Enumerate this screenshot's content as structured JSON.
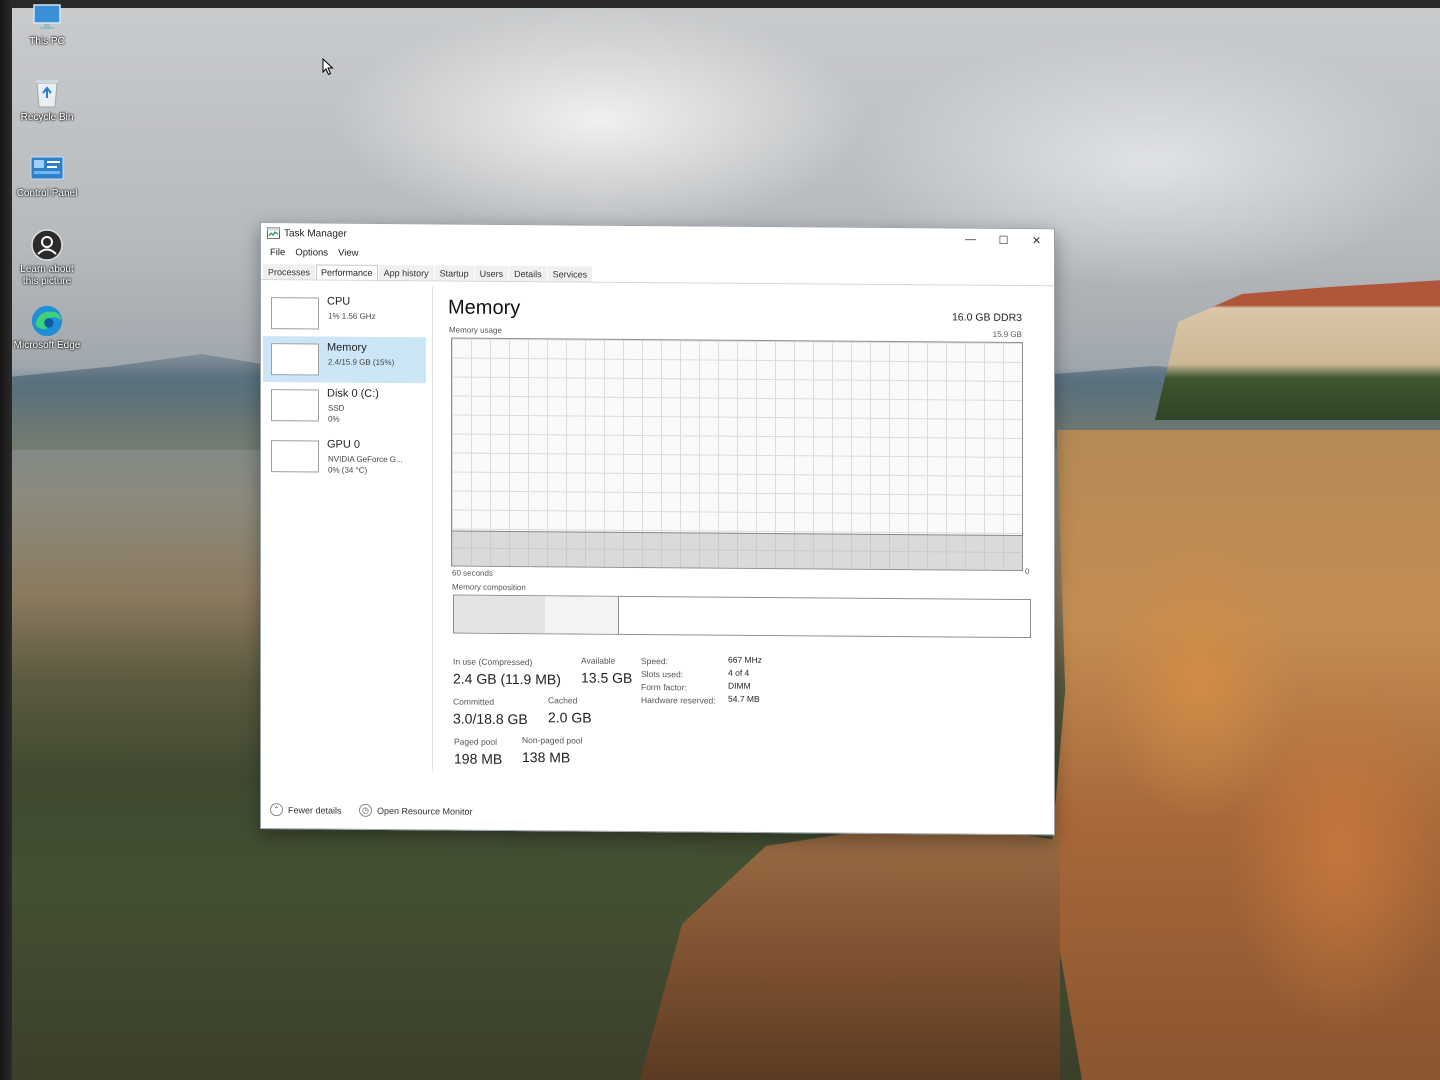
{
  "desktop": {
    "icons": [
      {
        "label": "This PC",
        "icon": "monitor-icon"
      },
      {
        "label": "Recycle Bin",
        "icon": "recycle-bin-icon"
      },
      {
        "label": "Control Panel",
        "icon": "control-panel-icon"
      },
      {
        "label": "Learn about this picture",
        "icon": "camera-icon"
      },
      {
        "label": "Microsoft Edge",
        "icon": "edge-icon"
      }
    ]
  },
  "window": {
    "title": "Task Manager",
    "controls": {
      "minimize": "—",
      "maximize": "☐",
      "close": "✕"
    },
    "menu": [
      "File",
      "Options",
      "View"
    ],
    "tabs": [
      "Processes",
      "Performance",
      "App history",
      "Startup",
      "Users",
      "Details",
      "Services"
    ],
    "active_tab": "Performance"
  },
  "sidebar": {
    "items": [
      {
        "name": "CPU",
        "line1": "1%  1.56 GHz",
        "line2": ""
      },
      {
        "name": "Memory",
        "line1": "2.4/15.9 GB (15%)",
        "line2": ""
      },
      {
        "name": "Disk 0 (C:)",
        "line1": "SSD",
        "line2": "0%"
      },
      {
        "name": "GPU 0",
        "line1": "NVIDIA GeForce G...",
        "line2": "0%  (34 °C)"
      }
    ],
    "selected": "Memory"
  },
  "memory": {
    "title": "Memory",
    "spec": "16.0 GB DDR3",
    "usage_label": "Memory usage",
    "usage_max": "15.9 GB",
    "time_left": "60 seconds",
    "time_right": "0",
    "usage_fraction": 0.15,
    "composition_label": "Memory composition",
    "composition": {
      "in_use": 0.158,
      "modified": 0.127
    },
    "stats": {
      "in_use_label": "In use (Compressed)",
      "in_use_value": "2.4 GB (11.9 MB)",
      "available_label": "Available",
      "available_value": "13.5 GB",
      "committed_label": "Committed",
      "committed_value": "3.0/18.8 GB",
      "cached_label": "Cached",
      "cached_value": "2.0 GB",
      "paged_label": "Paged pool",
      "paged_value": "198 MB",
      "nonpaged_label": "Non-paged pool",
      "nonpaged_value": "138 MB"
    },
    "details": [
      {
        "key": "Speed:",
        "value": "667 MHz"
      },
      {
        "key": "Slots used:",
        "value": "4 of 4"
      },
      {
        "key": "Form factor:",
        "value": "DIMM"
      },
      {
        "key": "Hardware reserved:",
        "value": "54.7 MB"
      }
    ]
  },
  "footer": {
    "fewer_details": "Fewer details",
    "open_resource_monitor": "Open Resource Monitor"
  },
  "colors": {
    "accent_selected": "#cde6f7",
    "graph_grid": "#dcdcdc",
    "graph_border": "#8f8f8f"
  }
}
